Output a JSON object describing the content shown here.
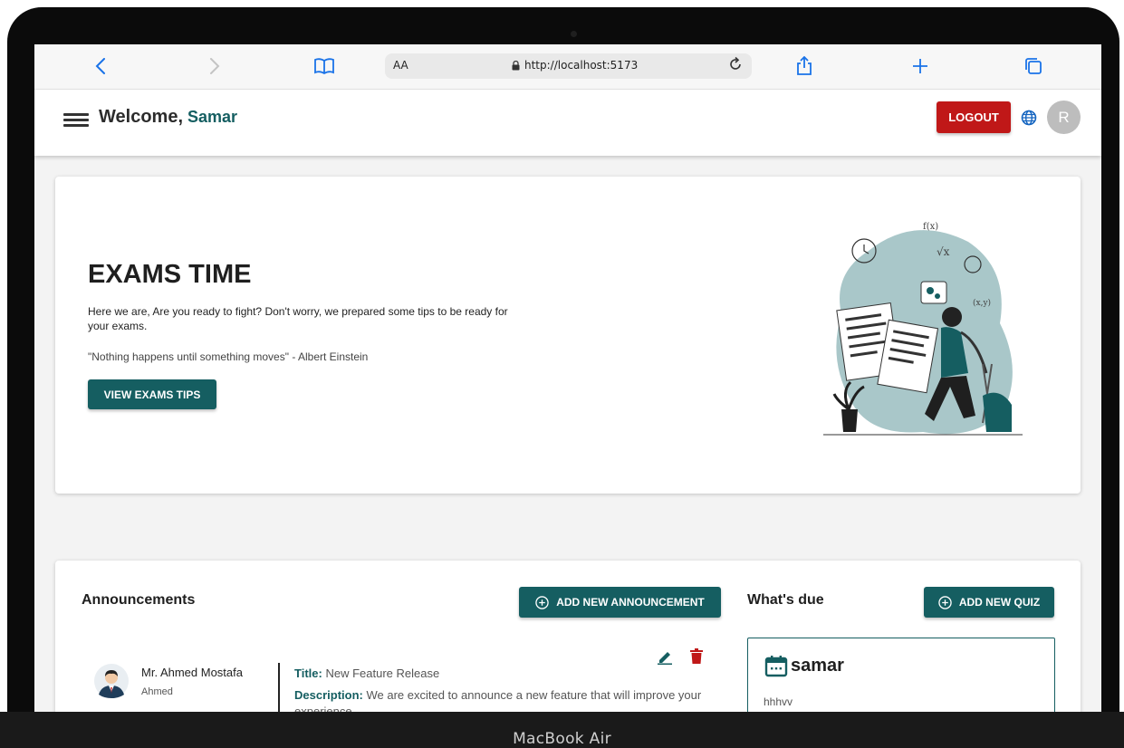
{
  "browser": {
    "text_size_label": "AA",
    "url": "http://localhost:5173"
  },
  "header": {
    "welcome_label": "Welcome,",
    "user_name": "Samar",
    "logout_label": "LOGOUT",
    "avatar_initial": "R"
  },
  "banner": {
    "title": "EXAMS TIME",
    "description": "Here we are, Are you ready to fight? Don't worry, we prepared some tips to be ready for your exams.",
    "quote": "\"Nothing happens until something moves\" - Albert Einstein",
    "button_label": "VIEW EXAMS TIPS"
  },
  "announcements": {
    "title": "Announcements",
    "add_button_label": "ADD NEW ANNOUNCEMENT",
    "items": [
      {
        "author": "Mr. Ahmed Mostafa",
        "username": "Ahmed",
        "title_label": "Title:",
        "title": "New Feature Release",
        "description_label": "Description:",
        "description": "We are excited to announce a new feature that will improve your experience."
      }
    ]
  },
  "whats_due": {
    "title": "What's due",
    "add_button_label": "ADD NEW QUIZ",
    "items": [
      {
        "name": "samar",
        "subtitle": "hhhvv"
      }
    ]
  },
  "device": {
    "model_label": "MacBook Air"
  },
  "colors": {
    "primary": "#155e61",
    "danger": "#c01818",
    "accent_blue": "#1565c0"
  }
}
